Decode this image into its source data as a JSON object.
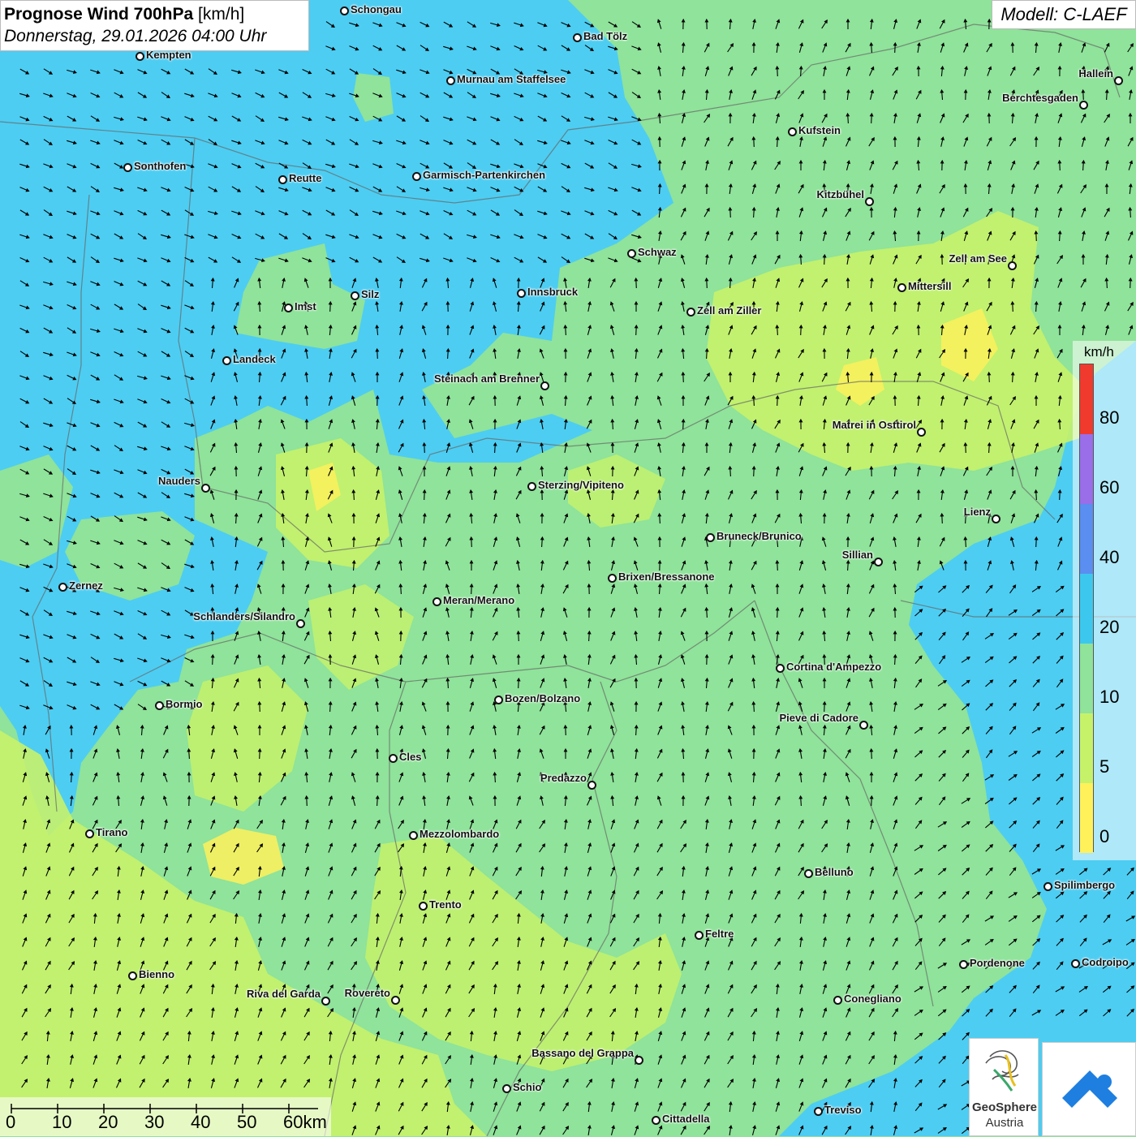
{
  "header": {
    "title_bold": "Prognose Wind 700hPa",
    "title_unit": "[km/h]",
    "datetime": "Donnerstag, 29.01.2026 04:00 Uhr",
    "model": "Modell: C-LAEF"
  },
  "legend": {
    "unit": "km/h",
    "ticks": [
      "80",
      "60",
      "40",
      "20",
      "10",
      "5",
      "0"
    ],
    "colors": [
      "#f03a2e",
      "#9a6ee8",
      "#5a8ef0",
      "#3cc8ee",
      "#8fe39a",
      "#c6f26a",
      "#fff15a"
    ]
  },
  "scale": {
    "labels": [
      "0",
      "10",
      "20",
      "30",
      "40",
      "50",
      "60km"
    ]
  },
  "logo": {
    "name": "GeoSphere",
    "country": "Austria"
  },
  "cities": [
    {
      "name": "Schongau"
    },
    {
      "name": "Bad Tölz"
    },
    {
      "name": "Kempten"
    },
    {
      "name": "Murnau am Staffelsee"
    },
    {
      "name": "Hallein"
    },
    {
      "name": "Berchtesgaden"
    },
    {
      "name": "Kufstein"
    },
    {
      "name": "Sonthofen"
    },
    {
      "name": "Reutte"
    },
    {
      "name": "Garmisch-Partenkirchen"
    },
    {
      "name": "Kitzbühel"
    },
    {
      "name": "Schwaz"
    },
    {
      "name": "Zell am See"
    },
    {
      "name": "Mittersill"
    },
    {
      "name": "Innsbruck"
    },
    {
      "name": "Silz"
    },
    {
      "name": "Imst"
    },
    {
      "name": "Zell am Ziller"
    },
    {
      "name": "Landeck"
    },
    {
      "name": "Steinach am Brenner"
    },
    {
      "name": "Matrei in Osttirol"
    },
    {
      "name": "Nauders"
    },
    {
      "name": "Sterzing/Vipiteno"
    },
    {
      "name": "Lienz"
    },
    {
      "name": "Bruneck/Brunico"
    },
    {
      "name": "Sillian"
    },
    {
      "name": "Brixen/Bressanone"
    },
    {
      "name": "Zernez"
    },
    {
      "name": "Meran/Merano"
    },
    {
      "name": "Schlanders/Silandro"
    },
    {
      "name": "Cortina d'Ampezzo"
    },
    {
      "name": "Bozen/Bolzano"
    },
    {
      "name": "Bormio"
    },
    {
      "name": "Pieve di Cadore"
    },
    {
      "name": "Cles"
    },
    {
      "name": "Predazzo"
    },
    {
      "name": "Tirano"
    },
    {
      "name": "Mezzolombardo"
    },
    {
      "name": "Belluno"
    },
    {
      "name": "Spilimbergo"
    },
    {
      "name": "Trento"
    },
    {
      "name": "Feltre"
    },
    {
      "name": "Pordenone"
    },
    {
      "name": "Codroipo"
    },
    {
      "name": "Bienno"
    },
    {
      "name": "Riva del Garda"
    },
    {
      "name": "Rovereto"
    },
    {
      "name": "Conegliano"
    },
    {
      "name": "Bassano del Grappa"
    },
    {
      "name": "Schio"
    },
    {
      "name": "Treviso"
    },
    {
      "name": "Cittadella"
    }
  ]
}
